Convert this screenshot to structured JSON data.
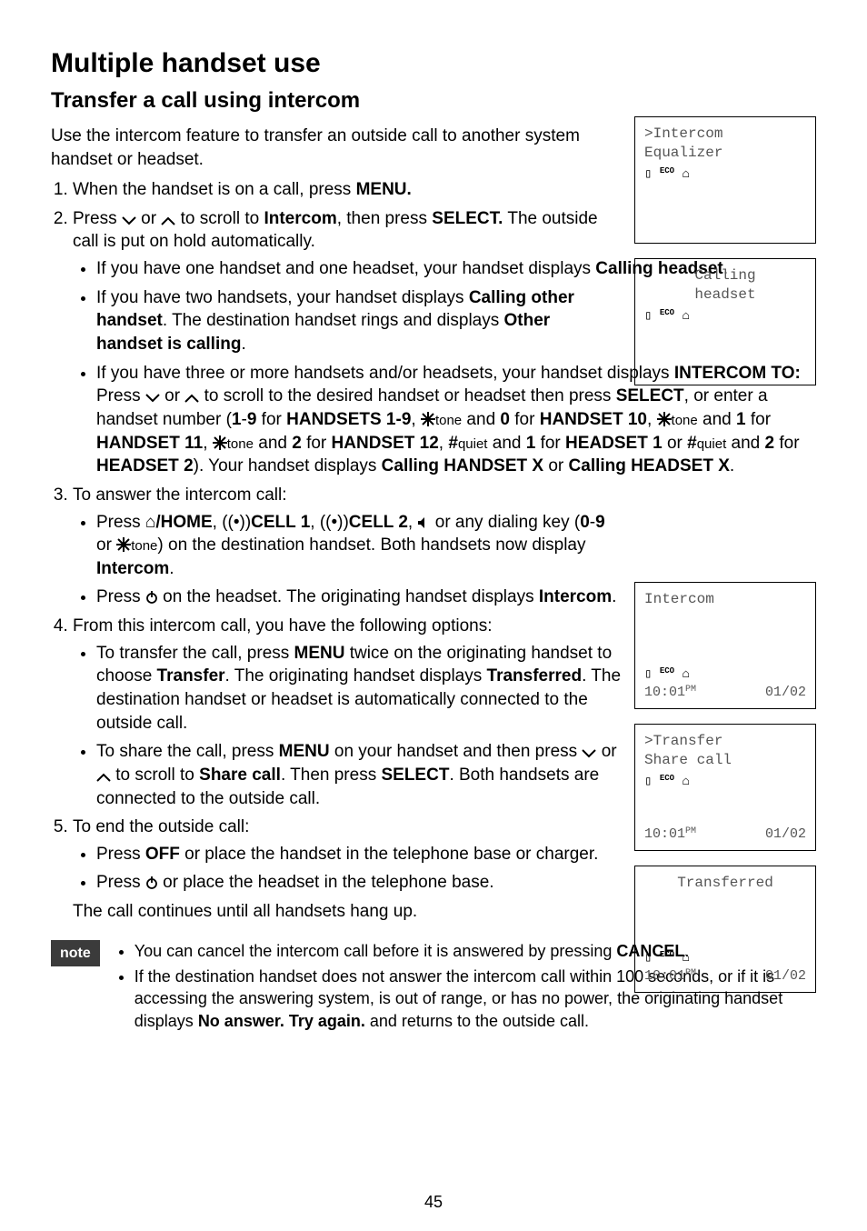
{
  "headings": {
    "h1": "Multiple handset use",
    "h2": "Transfer a call using intercom"
  },
  "intro": "Use the intercom feature to transfer an outside call to another system handset or headset.",
  "steps": {
    "s1": {
      "pre": "When the handset is on a call, press ",
      "b1": "MENU."
    },
    "s2": {
      "pre": "Press ",
      "mid1": " or ",
      "mid2": " to scroll to ",
      "b1": "Intercom",
      "mid3": ", then press ",
      "b2": "SELECT.",
      "post": " The outside call is put on hold automatically.",
      "bullets": {
        "b1a": "If you have one handset and one headset, your handset displays ",
        "b1b": "Calling headset",
        "b1c": ".",
        "b2a": "If you have two handsets, your handset displays ",
        "b2b": "Calling other handset",
        "b2c": ". The destination handset rings and displays ",
        "b2d": "Other handset is calling",
        "b2e": ".",
        "b3a": "If you have three or more handsets and/or headsets, your handset displays ",
        "b3b": "INTERCOM TO:",
        "b3c": " Press ",
        "b3d": " or ",
        "b3e": " to scroll to the desired handset or headset then press ",
        "b3f": "SELECT",
        "b3g": ", or enter a handset number (",
        "b3h": "1",
        "b3i": "-",
        "b3j": "9",
        "b3k": " for ",
        "b3l": "HANDSETS 1-9",
        "b3m": ", ",
        "b3m_tone": "tone",
        "b3n": " and ",
        "b3o": "0",
        "b3p": " for ",
        "b3q": "HANDSET 10",
        "b3r": ", ",
        "b3s": " and ",
        "b3t": "1",
        "b3u": " for ",
        "b3v": "HANDSET 11",
        "b3w": ", ",
        "b3x": " and ",
        "b3y": "2",
        "b3z": " for ",
        "b3aa": "HANDSET 12",
        "b3ab": ", ",
        "b3ab_quiet": "quiet",
        "b3ac": " and ",
        "b3ad": "1",
        "b3ae": " for ",
        "b3af": "HEADSET 1",
        "b3ag": " or ",
        "b3ah": " and ",
        "b3ai": "2",
        "b3aj": " for ",
        "b3ak": "HEADSET 2",
        "b3al": "). Your handset displays ",
        "b3am": "Calling HANDSET X",
        "b3an": " or ",
        "b3ao": "Calling HEADSET X",
        "b3ap": "."
      }
    },
    "s3": {
      "pre": "To answer the intercom call:",
      "bullets": {
        "b1a": "Press ",
        "b1b": "/HOME",
        "b1c": ", ",
        "b1d": "CELL 1",
        "b1e": ", ",
        "b1f": "CELL 2",
        "b1g": ", ",
        "b1h": " or any dialing key (",
        "b1i": "0",
        "b1j": "-",
        "b1k": "9",
        "b1l": " or ",
        "b1l_tone": "tone",
        "b1m": ") on the destination handset. Both handsets now display ",
        "b1n": "Intercom",
        "b1o": ".",
        "b2a": "Press ",
        "b2b": " on the headset. The originating handset displays ",
        "b2c": "Intercom",
        "b2d": "."
      }
    },
    "s4": {
      "pre": "From this intercom call, you have the following options:",
      "bullets": {
        "b1a": "To transfer the call, press ",
        "b1b": "MENU",
        "b1c": " twice on the originating handset to choose ",
        "b1d": "Transfer",
        "b1e": ". The originating handset displays ",
        "b1f": "Transferred",
        "b1g": ". The destination handset or headset is automatically connected to the outside call.",
        "b2a": "To share the call, press ",
        "b2b": "MENU",
        "b2c": " on your handset and then press ",
        "b2d": " or ",
        "b2e": " to scroll to ",
        "b2f": "Share call",
        "b2g": ". Then press ",
        "b2h": "SELECT",
        "b2i": ". Both handsets are connected to the outside call."
      }
    },
    "s5": {
      "pre": "To end the outside call:",
      "bullets": {
        "b1a": "Press ",
        "b1b": "OFF",
        "b1c": " or place the handset in the telephone base or charger.",
        "b2a": "Press ",
        "b2b": " or place the headset in the telephone base."
      },
      "after": "The call continues until all handsets hang up."
    }
  },
  "note": {
    "tag": "note",
    "n1a": "You can cancel the intercom call before it is answered by pressing ",
    "n1b": "CANCEL",
    "n1c": ".",
    "n2": "If the destination handset does not answer the intercom call within 100 seconds, or if it is accessing the answering system, is out of range, or has no power, the originating handset displays ",
    "n2b": "No answer. Try again.",
    "n2c": " and returns to the outside call."
  },
  "lcds": {
    "lcd1": {
      "line1": ">Intercom",
      "line2": " Equalizer"
    },
    "lcd2": {
      "line1": "Calling",
      "line2": "headset"
    },
    "lcd3": {
      "line1": "Intercom",
      "time": "10:01",
      "ampm": "PM",
      "date": "01/02"
    },
    "lcd4": {
      "line1": ">Transfer",
      "line2": " Share call",
      "time": "10:01",
      "ampm": "PM",
      "date": "01/02"
    },
    "lcd5": {
      "line1": "Transferred",
      "time": "10:01",
      "ampm": "PM",
      "date": "01/02"
    }
  },
  "icons": {
    "battery": "▯",
    "eco": "ECO",
    "home_small": "⌂"
  },
  "page": "45"
}
